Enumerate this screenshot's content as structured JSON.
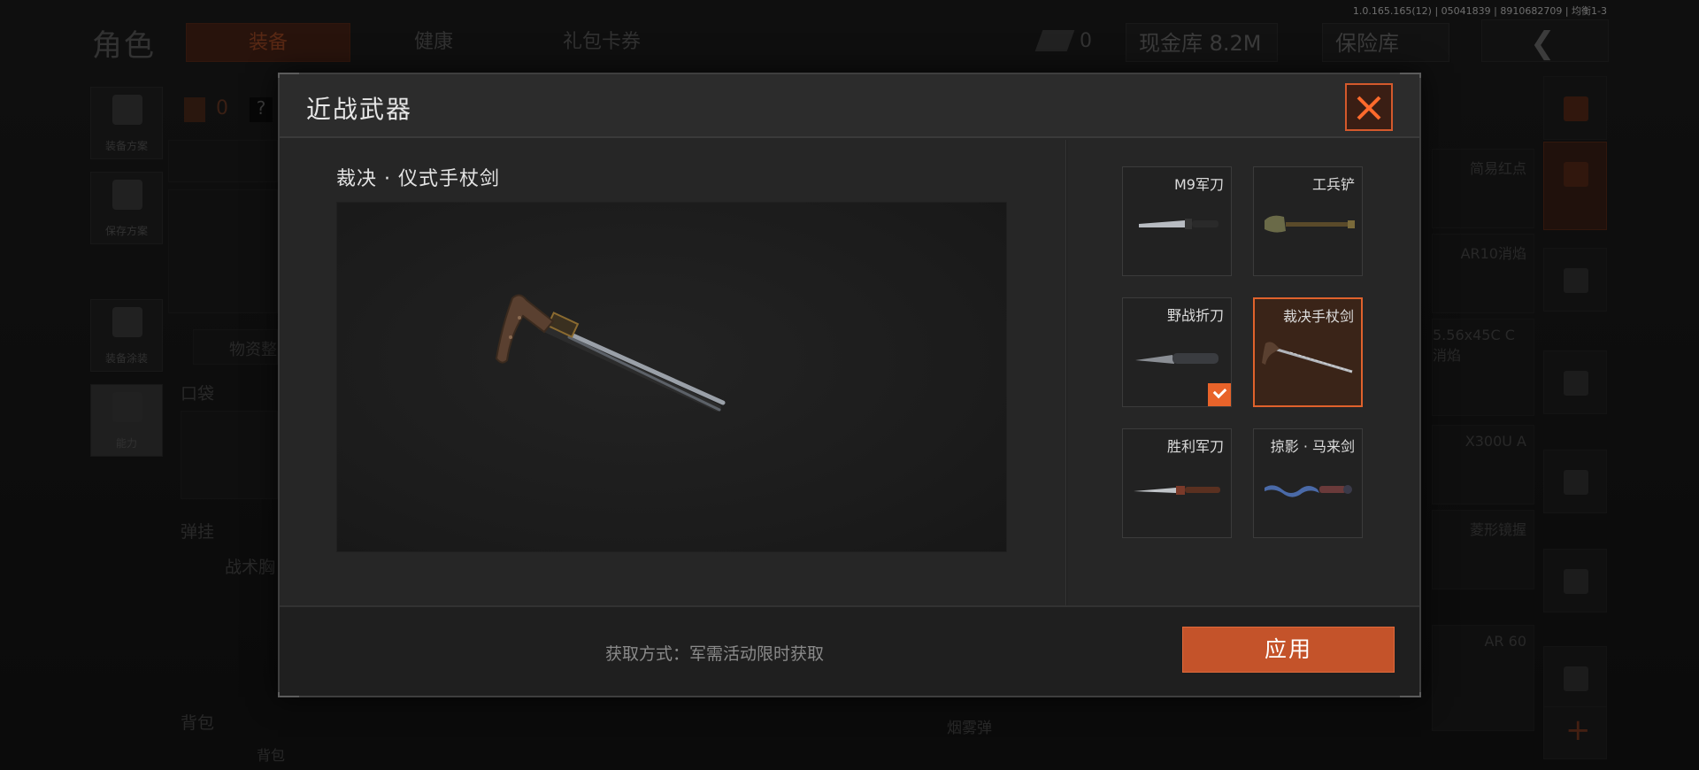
{
  "version": "1.0.165.165(12) | 05041839 | 8910682709 | 均衡1-3",
  "background": {
    "title": "角色",
    "tabs": [
      {
        "label": "装备",
        "active": true
      },
      {
        "label": "健康",
        "active": false
      },
      {
        "label": "礼包卡券",
        "active": false
      }
    ],
    "ticket_count": "0",
    "cash_label": "现金库 8.2M",
    "vault_label": "保险库",
    "side_buttons": [
      {
        "label": "装备方案"
      },
      {
        "label": "保存方案"
      },
      {
        "label": "装备涂装"
      },
      {
        "label": "能力"
      }
    ],
    "loadout_count": "0",
    "help_mark": "?",
    "sections": [
      "口袋",
      "弹挂",
      "背包"
    ],
    "rig_label": "战术胸",
    "supply_label": "物资整",
    "backpack_sub": "背包",
    "grenade_label": "烟雾弹",
    "right_items": [
      "简易红点",
      "AR10消焰",
      "5.56x45C C 消焰",
      "X300U A",
      "菱形镜握",
      "AR 60"
    ],
    "accent_color": "#e0622c"
  },
  "modal": {
    "title": "近战武器",
    "preview_name": "裁决 · 仪式手杖剑",
    "weapons": [
      {
        "name": "M9军刀",
        "icon": "bayonet-icon",
        "selected": false,
        "equipped": false
      },
      {
        "name": "工兵铲",
        "icon": "shovel-icon",
        "selected": false,
        "equipped": false
      },
      {
        "name": "野战折刀",
        "icon": "folding-knife-icon",
        "selected": false,
        "equipped": true
      },
      {
        "name": "裁决手杖剑",
        "icon": "cane-sword-icon",
        "selected": true,
        "equipped": false
      },
      {
        "name": "胜利军刀",
        "icon": "saber-icon",
        "selected": false,
        "equipped": false
      },
      {
        "name": "掠影 · 马来剑",
        "icon": "kris-icon",
        "selected": false,
        "equipped": false
      }
    ],
    "acquire_text": "获取方式：军需活动限时获取",
    "apply_label": "应用"
  }
}
